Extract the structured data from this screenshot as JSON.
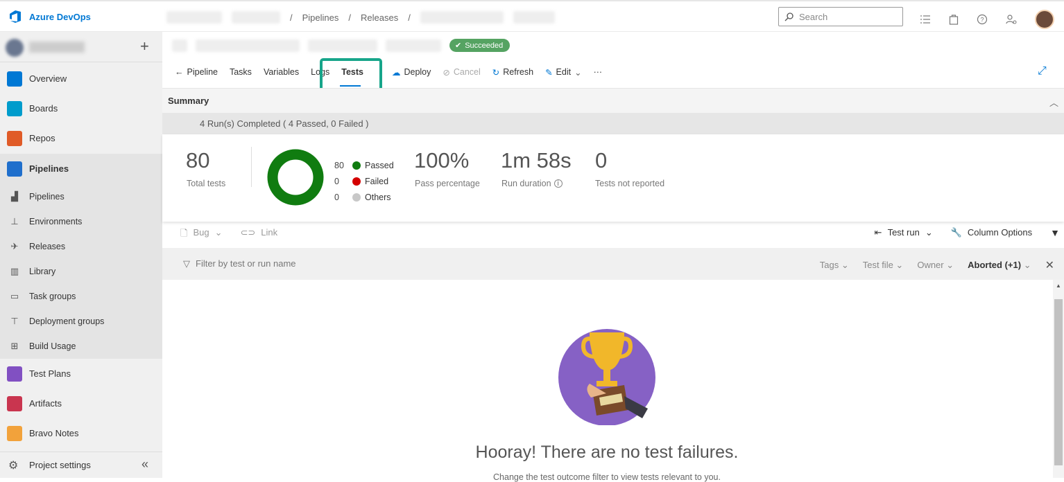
{
  "app": {
    "name": "Azure DevOps"
  },
  "breadcrumb": {
    "pipelines": "Pipelines",
    "releases": "Releases",
    "sep": "/"
  },
  "search": {
    "placeholder": "Search"
  },
  "sidebar": {
    "items": [
      {
        "label": "Overview",
        "color": "#0078d4"
      },
      {
        "label": "Boards",
        "color": "#009ccc"
      },
      {
        "label": "Repos",
        "color": "#e05b27"
      },
      {
        "label": "Pipelines",
        "color": "#1f6fcc"
      }
    ],
    "pipeline_subitems": [
      "Pipelines",
      "Environments",
      "Releases",
      "Library",
      "Task groups",
      "Deployment groups",
      "Build Usage"
    ],
    "lower_items": [
      {
        "label": "Test Plans",
        "color": "#8150c2"
      },
      {
        "label": "Artifacts",
        "color": "#c9354f"
      },
      {
        "label": "Bravo Notes",
        "color": "#f2a23b"
      }
    ],
    "settings": "Project settings"
  },
  "release": {
    "status": "Succeeded"
  },
  "tabs": {
    "pipeline": "Pipeline",
    "tasks": "Tasks",
    "variables": "Variables",
    "logs": "Logs",
    "tests": "Tests",
    "deploy": "Deploy",
    "cancel": "Cancel",
    "refresh": "Refresh",
    "edit": "Edit",
    "more": "···"
  },
  "summary": {
    "title": "Summary",
    "runs": "4 Run(s) Completed ( 4 Passed, 0 Failed )",
    "total": "80",
    "total_label": "Total tests",
    "passed": "80",
    "passed_label": "Passed",
    "failed": "0",
    "failed_label": "Failed",
    "others": "0",
    "others_label": "Others",
    "pass_pct": "100%",
    "pass_pct_label": "Pass percentage",
    "duration": "1m 58s",
    "duration_label": "Run duration",
    "not_reported": "0",
    "not_reported_label": "Tests not reported",
    "colors": {
      "passed": "#107c10",
      "failed": "#d40000",
      "others": "#c8c8c8"
    },
    "chart_data": {
      "type": "pie",
      "categories": [
        "Passed",
        "Failed",
        "Others"
      ],
      "values": [
        80,
        0,
        0
      ]
    }
  },
  "toolbar2": {
    "bug": "Bug",
    "link": "Link",
    "test_run": "Test run",
    "column_options": "Column Options"
  },
  "filter": {
    "placeholder": "Filter by test or run name",
    "tags": "Tags",
    "test_file": "Test file",
    "owner": "Owner",
    "outcome": "Aborted (+1)"
  },
  "empty_state": {
    "title": "Hooray! There are no test failures.",
    "subtitle": "Change the test outcome filter to view tests relevant to you."
  }
}
